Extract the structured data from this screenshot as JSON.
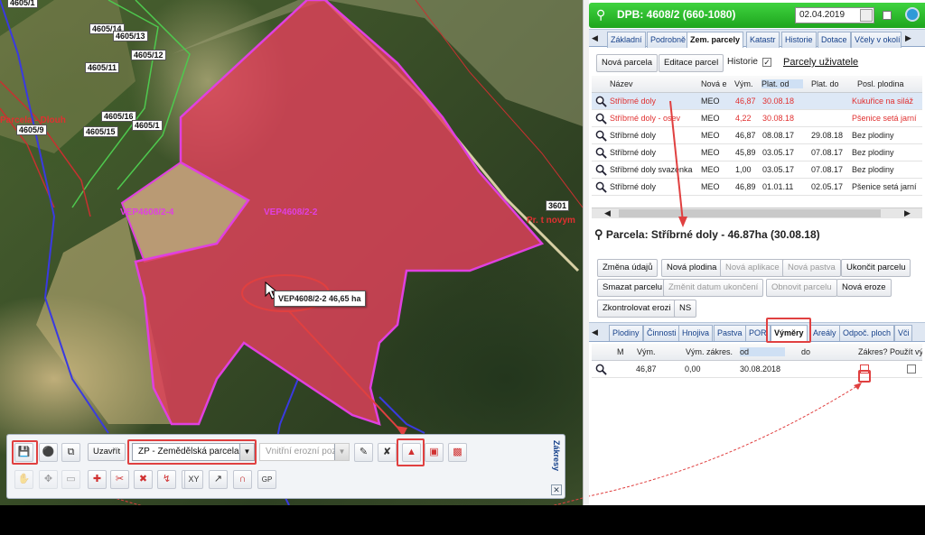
{
  "map": {
    "parcel_labels_top": [
      "4605/1",
      "4605/14",
      "4605/13",
      "4605/12",
      "4605/11",
      "4605/16",
      "4605/1",
      "4605/15",
      "4605/9"
    ],
    "parcel_top_left_red": "Parcela - Dlouh",
    "vep_label_left": "VEP4608/2-4",
    "vep_label_center": "VEP4608/2-2",
    "label_3601": "3601",
    "label_right_red": "Pr. t novym",
    "tooltip": "VEP4608/2-2 46,65 ha",
    "colors": {
      "parcel_fill": "#e0415a",
      "parcel_border": "#e040e0",
      "annot": "#e04040"
    }
  },
  "toolbar": {
    "close_label": "Uzavřít",
    "layer_select": "ZP - Zemědělská parcela",
    "erosion_select": "Vnitřní erozní poze",
    "side_title": "Zákresy",
    "close_x": "✕"
  },
  "panel": {
    "title": "DPB: 4608/2 (660-1080)",
    "date": "02.04.2019",
    "tabs": [
      "Základní",
      "Podrobně",
      "Zem. parcely",
      "Katastr",
      "Historie",
      "Dotace",
      "Včely v okolí"
    ],
    "btn_new_parcel": "Nová parcela",
    "btn_edit_parcel": "Editace parcel",
    "history_label": "Historie",
    "user_parcels_link": "Parcely uživatele",
    "columns": [
      "Název",
      "Nová e",
      "Vým.",
      "Plat. od",
      "Plat. do",
      "Posl. plodina"
    ],
    "rows": [
      {
        "name": "Stříbrné doly",
        "type": "MEO",
        "area": "46,87",
        "from": "30.08.18",
        "to": "",
        "crop": "Kukuřice na siláž",
        "red": true,
        "selected": true
      },
      {
        "name": "Stříbrné doly - osev",
        "type": "MEO",
        "area": "4,22",
        "from": "30.08.18",
        "to": "",
        "crop": "Pšenice setá jarní",
        "red": true,
        "selected": false
      },
      {
        "name": "Stříbrné doly",
        "type": "MEO",
        "area": "46,87",
        "from": "08.08.17",
        "to": "29.08.18",
        "crop": "Bez plodiny",
        "red": false,
        "selected": false
      },
      {
        "name": "Stříbrné doly",
        "type": "MEO",
        "area": "45,89",
        "from": "03.05.17",
        "to": "07.08.17",
        "crop": "Bez plodiny",
        "red": false,
        "selected": false
      },
      {
        "name": "Stříbrné doly svazenka",
        "type": "MEO",
        "area": "1,00",
        "from": "03.05.17",
        "to": "07.08.17",
        "crop": "Bez plodiny",
        "red": false,
        "selected": false
      },
      {
        "name": "Stříbrné doly",
        "type": "MEO",
        "area": "46,89",
        "from": "01.01.11",
        "to": "02.05.17",
        "crop": "Pšenice setá jarní",
        "red": false,
        "selected": false
      }
    ],
    "parcel_title": "Parcela: Stříbrné doly - 46.87ha (30.08.18)",
    "actions": [
      "Změna údajů",
      "Nová plodina",
      "Nová aplikace",
      "Nová pastva",
      "Ukončit parcelu",
      "Smazat parcelu",
      "Změnit datum ukončení",
      "Obnovit parcelu",
      "Nová eroze",
      "Zkontrolovat erozi",
      "NS"
    ],
    "subtabs": [
      "Plodiny",
      "Činnosti",
      "Hnojiva",
      "Pastva",
      "POR",
      "Výměry",
      "Areály",
      "Odpoč. ploch",
      "Vči"
    ],
    "sub_columns": [
      "M",
      "Vým.",
      "Vým. zákres.",
      "od",
      "do",
      "Zákres?",
      "Použít vý"
    ],
    "sub_row": {
      "area": "46,87",
      "area_draw": "0,00",
      "from": "30.08.2018"
    }
  }
}
